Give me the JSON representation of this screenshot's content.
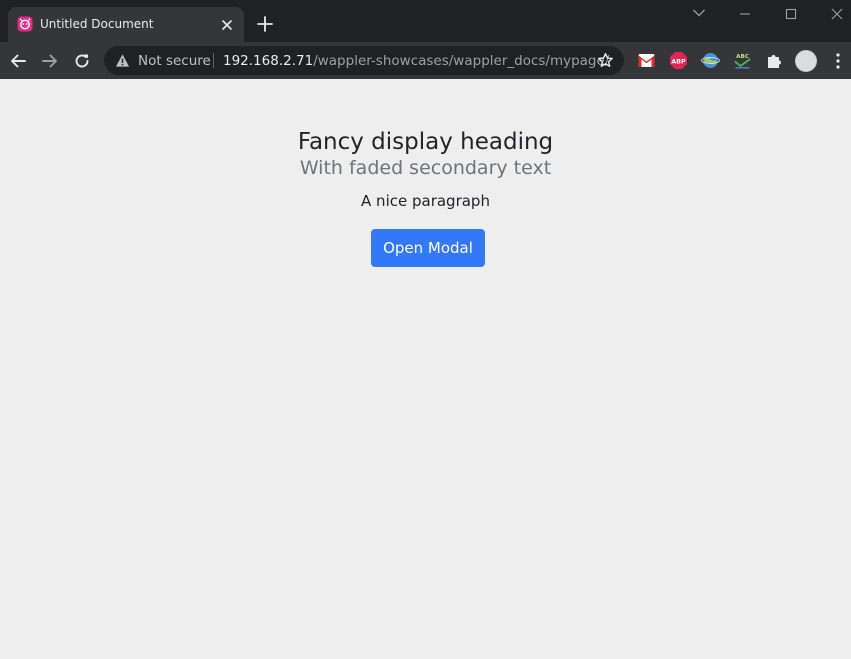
{
  "browser": {
    "tab": {
      "title": "Untitled Document",
      "favicon": "wappler-icon"
    },
    "address_bar": {
      "security_label": "Not secure",
      "url_host": "192.168.2.71",
      "url_path": "/wappler-showcases/wappler_docs/mypage/"
    },
    "extensions": [
      "gmail-checker-icon",
      "adblock-plus-icon",
      "globe-extension-icon",
      "spellcheck-extension-icon",
      "puzzle-extensions-icon"
    ],
    "colors": {
      "tabstrip": "#202124",
      "toolbar": "#35363a",
      "favicon": "#e52e8b",
      "adblock": "#e2264f"
    }
  },
  "page": {
    "heading": "Fancy display heading",
    "subheading": "With faded secondary text",
    "paragraph": "A nice paragraph",
    "button_label": "Open Modal",
    "colors": {
      "background": "#eeeeee",
      "button": "#3378f6",
      "muted_text": "#6c757d"
    }
  }
}
